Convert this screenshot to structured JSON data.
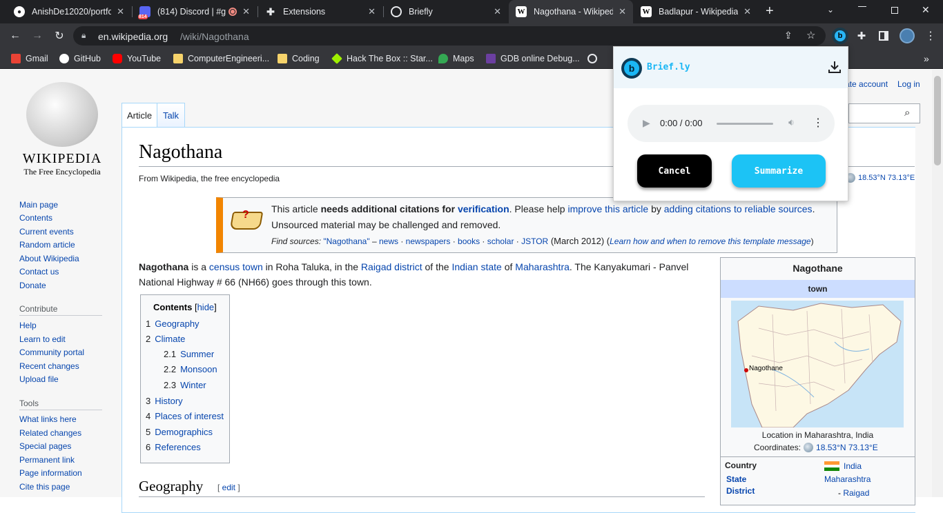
{
  "tabs": [
    {
      "title": "AnishDe12020/portfol",
      "icon": "github-icon"
    },
    {
      "title": "(814) Discord | #g",
      "badge": "814",
      "icon": "discord-icon"
    },
    {
      "title": "Extensions",
      "icon": "puzzle-icon"
    },
    {
      "title": "Briefly",
      "icon": "globe-icon"
    },
    {
      "title": "Nagothana - Wikipedi",
      "icon": "wikipedia-icon",
      "active": true
    },
    {
      "title": "Badlapur - Wikipedia",
      "icon": "wikipedia-icon"
    }
  ],
  "address": {
    "host": "en.wikipedia.org",
    "path": "/wiki/Nagothana"
  },
  "bookmarks": [
    "Gmail",
    "GitHub",
    "YouTube",
    "ComputerEngineeri...",
    "Coding",
    "Hack The Box :: Star...",
    "Maps",
    "GDB online Debug..."
  ],
  "wiki": {
    "logo_title": "WIKIPEDIA",
    "logo_subtitle": "The Free Encyclopedia",
    "nav": [
      "Main page",
      "Contents",
      "Current events",
      "Random article",
      "About Wikipedia",
      "Contact us",
      "Donate"
    ],
    "contribute_heading": "Contribute",
    "contribute": [
      "Help",
      "Learn to edit",
      "Community portal",
      "Recent changes",
      "Upload file"
    ],
    "tools_heading": "Tools",
    "tools": [
      "What links here",
      "Related changes",
      "Special pages",
      "Permanent link",
      "Page information",
      "Cite this page"
    ],
    "tab_article": "Article",
    "tab_talk": "Talk",
    "create_account": "ate account",
    "log_in": "Log in",
    "title": "Nagothana",
    "from": "From Wikipedia, the free encyclopedia",
    "coords": "18.53°N 73.13°E",
    "notice": {
      "t1": "This article ",
      "t2": "needs additional citations for ",
      "t3": "verification",
      "t4": ". Please help ",
      "t5": "improve this article",
      "t6": " by ",
      "t7": "adding citations to reliable sources",
      "t8": ".",
      "line2": "Unsourced material may be challenged and removed.",
      "find": "Find sources: ",
      "q": "\"Nagothana\"",
      "dash": " – ",
      "news": "news",
      "dot": " · ",
      "newspapers": "newspapers",
      "books": "books",
      "scholar": "scholar",
      "jstor": "JSTOR",
      "date": " (March 2012) (",
      "learn": "Learn how and when to remove this template message",
      "close": ")"
    },
    "intro": {
      "b": "Nagothana",
      "t1": " is a ",
      "l1": "census town",
      "t2": " in Roha Taluka, in the ",
      "l2": "Raigad district",
      "t3": " of the ",
      "l3": "Indian state",
      "t4": " of ",
      "l4": "Maharashtra",
      "t5": ". The Kanyakumari - Panvel",
      "line2": "National Highway # 66 (NH66) goes through this town."
    },
    "toc": {
      "title": "Contents",
      "hide": "hide",
      "items": [
        {
          "n": "1",
          "t": "Geography"
        },
        {
          "n": "2",
          "t": "Climate"
        },
        {
          "n": "2.1",
          "t": "Summer"
        },
        {
          "n": "2.2",
          "t": "Monsoon"
        },
        {
          "n": "2.3",
          "t": "Winter"
        },
        {
          "n": "3",
          "t": "History"
        },
        {
          "n": "4",
          "t": "Places of interest"
        },
        {
          "n": "5",
          "t": "Demographics"
        },
        {
          "n": "6",
          "t": "References"
        }
      ]
    },
    "section_geography": "Geography",
    "edit": "edit",
    "infobox": {
      "title": "Nagothane",
      "type": "town",
      "marker": "Nagothane",
      "caption": "Location in Maharashtra, India",
      "coords_label": "Coordinates:",
      "coords": "18.53°N 73.13°E",
      "rows": [
        {
          "k": "Country",
          "v": "India"
        },
        {
          "k": "State",
          "v": "Maharashtra"
        },
        {
          "k": "District",
          "v": "Raigad"
        }
      ]
    }
  },
  "popup": {
    "brand": "Brief.ly",
    "time": "0:00 / 0:00",
    "cancel": "Cancel",
    "summarize": "Summarize"
  }
}
